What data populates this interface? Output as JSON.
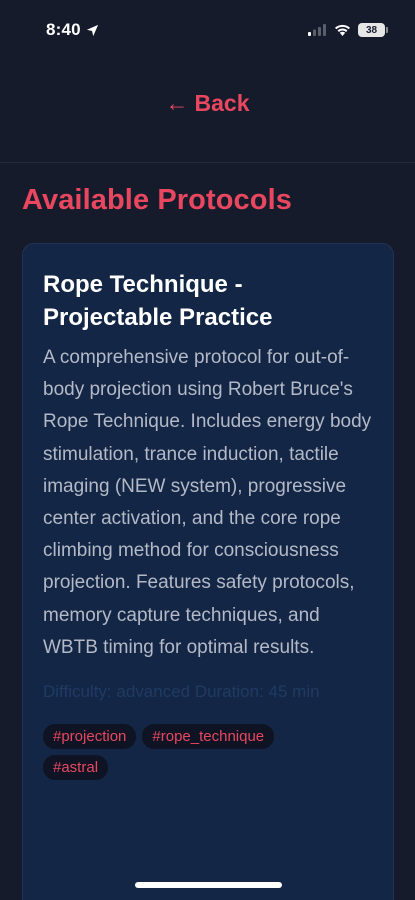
{
  "status": {
    "time": "8:40",
    "battery": "38"
  },
  "header": {
    "back_label": "Back",
    "back_arrow": "←"
  },
  "section_title": "Available Protocols",
  "protocol": {
    "title": "Rope Technique - Projectable Practice",
    "description": "A comprehensive protocol for out-of-body projection using Robert Bruce's Rope Technique. Includes energy body stimulation, trance induction, tactile imaging (NEW system), progressive center activation, and the core rope climbing method for consciousness projection. Features safety protocols, memory capture techniques, and WBTB timing for optimal results.",
    "meta": "Difficulty: advanced  Duration: 45 min",
    "tags": [
      "#projection",
      "#rope_technique",
      "#astral"
    ]
  },
  "colors": {
    "accent": "#e8475f",
    "background": "#161b2c",
    "card": "#142645"
  },
  "icons": [
    "location-arrow-icon",
    "cellular-signal-icon",
    "wifi-icon",
    "battery-icon",
    "back-arrow-icon"
  ]
}
